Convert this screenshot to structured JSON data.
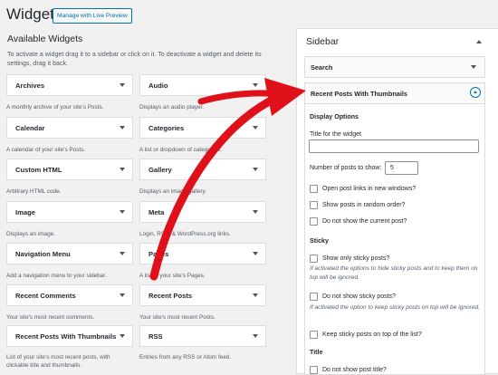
{
  "header": {
    "title": "Widgets",
    "manage_button": "Manage with Live Preview"
  },
  "available": {
    "title": "Available Widgets",
    "description": "To activate a widget drag it to a sidebar or click on it. To deactivate a widget and delete its settings, drag it back.",
    "widgets": [
      {
        "name": "Archives",
        "desc": "A monthly archive of your site's Posts."
      },
      {
        "name": "Audio",
        "desc": "Displays an audio player."
      },
      {
        "name": "Calendar",
        "desc": "A calendar of your site's Posts."
      },
      {
        "name": "Categories",
        "desc": "A list or dropdown of categories."
      },
      {
        "name": "Custom HTML",
        "desc": "Arbitrary HTML code."
      },
      {
        "name": "Gallery",
        "desc": "Displays an image gallery."
      },
      {
        "name": "Image",
        "desc": "Displays an image."
      },
      {
        "name": "Meta",
        "desc": "Login, RSS, & WordPress.org links."
      },
      {
        "name": "Navigation Menu",
        "desc": "Add a navigation menu to your sidebar."
      },
      {
        "name": "Pages",
        "desc": "A list of your site's Pages."
      },
      {
        "name": "Recent Comments",
        "desc": "Your site's most recent comments."
      },
      {
        "name": "Recent Posts",
        "desc": "Your site's most recent Posts."
      },
      {
        "name": "Recent Posts With Thumbnails",
        "desc": "List of your site's most recent posts, with clickable title and thumbnails."
      },
      {
        "name": "RSS",
        "desc": "Entries from any RSS or Atom feed."
      }
    ]
  },
  "sidebar": {
    "title": "Sidebar",
    "search_widget": "Search",
    "rp_widget": {
      "title": "Recent Posts With Thumbnails",
      "display_options": "Display Options",
      "title_label": "Title for the widget",
      "title_value": "",
      "num_posts_label": "Number of posts to show:",
      "num_posts_value": "5",
      "opt_new_window": "Open post links in new windows?",
      "opt_random": "Show posts in random order?",
      "opt_no_current": "Do not show the current post?",
      "sticky_head": "Sticky",
      "opt_sticky_only": "Show only sticky posts?",
      "help_sticky_only": "If activated the options to hide sticky posts and to keep them on top will be ignored.",
      "opt_no_sticky": "Do not show sticky posts?",
      "help_no_sticky": "If activated the option to keep sticky posts on top will be ignored.",
      "opt_keep_top": "Keep sticky posts on top of the list?",
      "title_head": "Title",
      "opt_no_title": "Do not show post title?"
    }
  },
  "colors": {
    "link": "#0073aa",
    "arrow": "#e0101a"
  }
}
